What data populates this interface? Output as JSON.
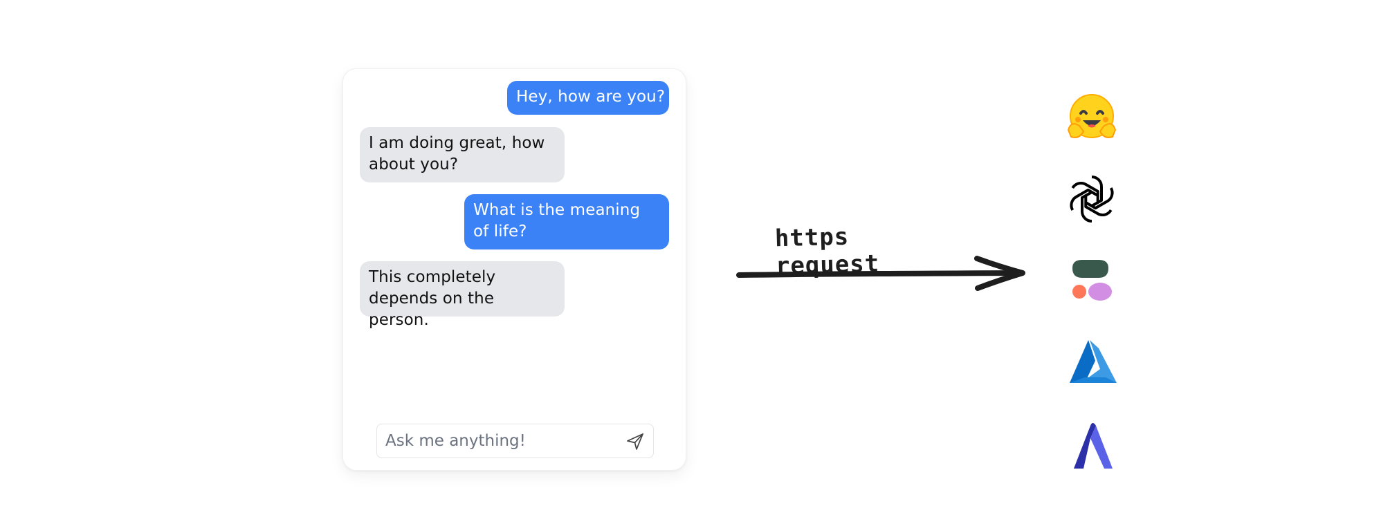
{
  "chat": {
    "messages": [
      {
        "role": "user",
        "text": "Hey, how are you?"
      },
      {
        "role": "assistant",
        "text": "I am doing great, how about you?"
      },
      {
        "role": "user",
        "text": "What is the meaning of life?"
      },
      {
        "role": "assistant",
        "text": "This completely depends on the person."
      }
    ],
    "input": {
      "placeholder": "Ask me anything!",
      "value": ""
    },
    "colors": {
      "user_bubble": "#3b82f6",
      "assistant_bubble": "#e5e7eb"
    }
  },
  "arrow": {
    "label": "https request"
  },
  "providers": [
    {
      "icon": "hugging-face-icon"
    },
    {
      "icon": "openai-icon"
    },
    {
      "icon": "cohere-icon"
    },
    {
      "icon": "azure-icon"
    },
    {
      "icon": "anyscale-icon"
    }
  ]
}
